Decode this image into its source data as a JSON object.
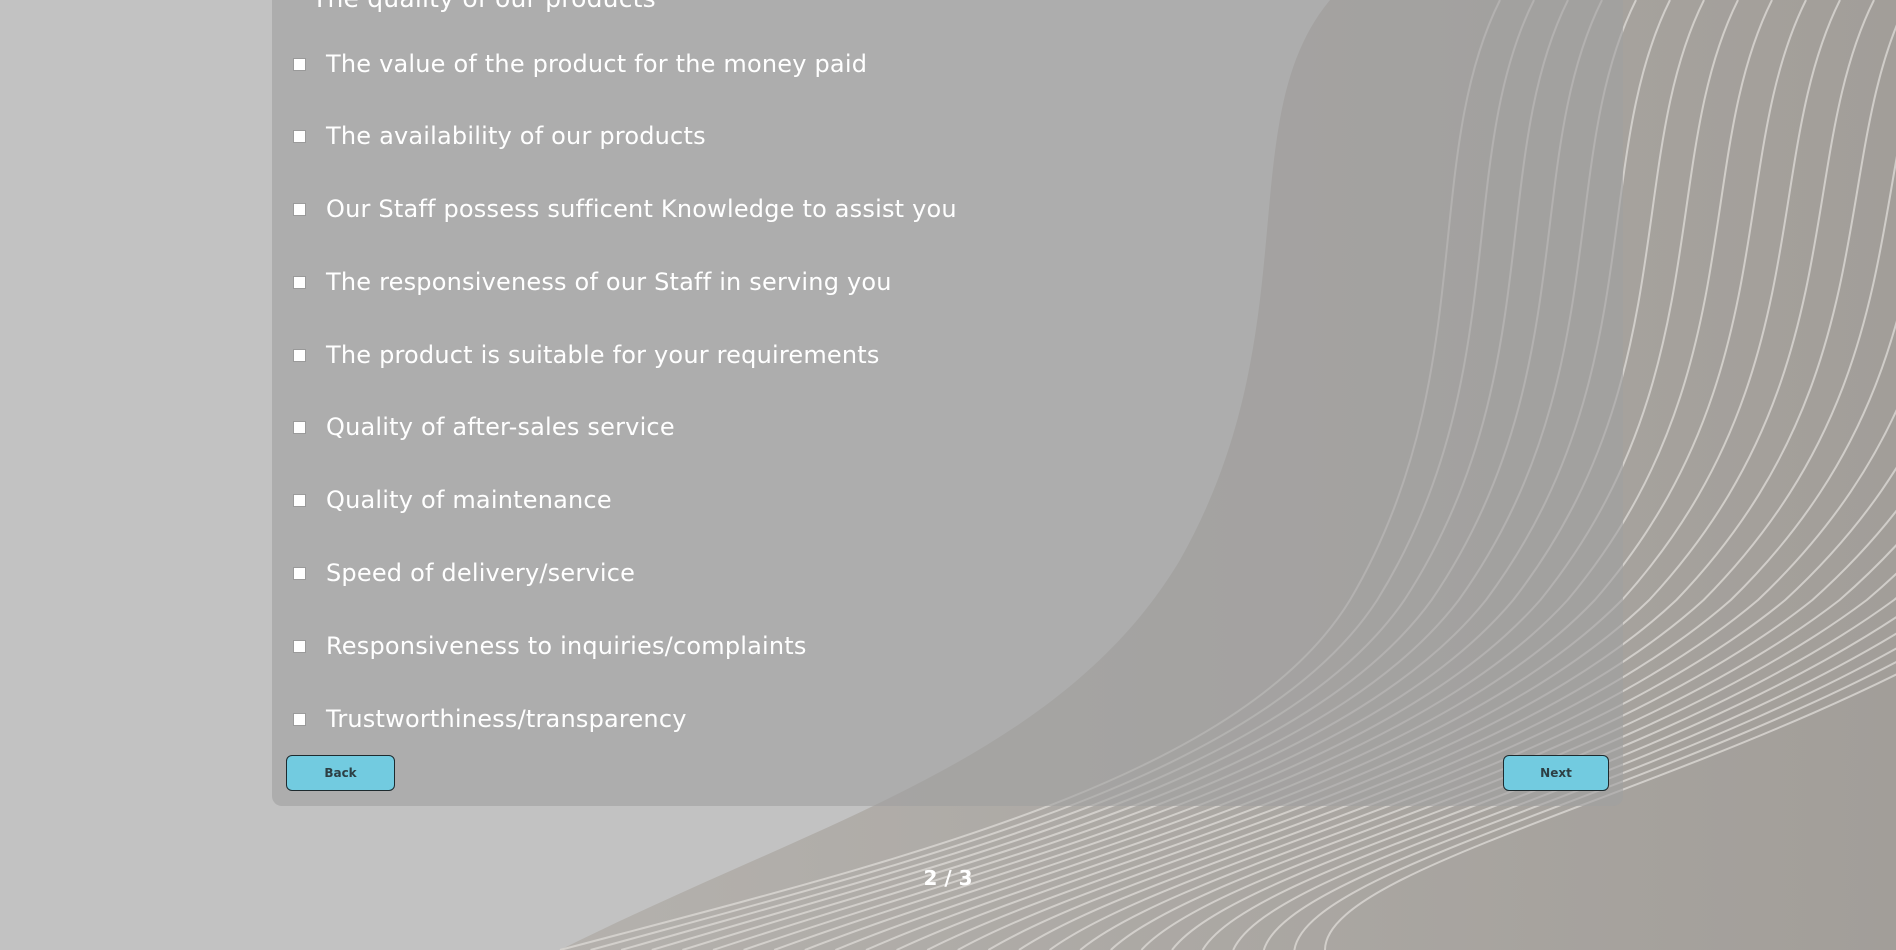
{
  "survey": {
    "partial_option": "The quality of our products",
    "options": [
      {
        "label": "The value of the product for the money paid",
        "checked": false
      },
      {
        "label": "The availability of our products",
        "checked": false
      },
      {
        "label": "Our Staff possess sufficent Knowledge to assist you",
        "checked": false
      },
      {
        "label": "The responsiveness of our Staff in serving you",
        "checked": false
      },
      {
        "label": "The product is suitable for your requirements",
        "checked": false
      },
      {
        "label": "Quality of after-sales service",
        "checked": false
      },
      {
        "label": "Quality of maintenance",
        "checked": false
      },
      {
        "label": "Speed of delivery/service",
        "checked": false
      },
      {
        "label": "Responsiveness to inquiries/complaints",
        "checked": false
      },
      {
        "label": "Trustworthiness/transparency",
        "checked": false
      }
    ]
  },
  "nav": {
    "back_label": "Back",
    "next_label": "Next"
  },
  "pagination": {
    "text": "2 / 3"
  },
  "colors": {
    "button_bg": "#72cbe0",
    "panel_bg": "#a0a0a0",
    "page_bg": "#c3c3c3"
  }
}
